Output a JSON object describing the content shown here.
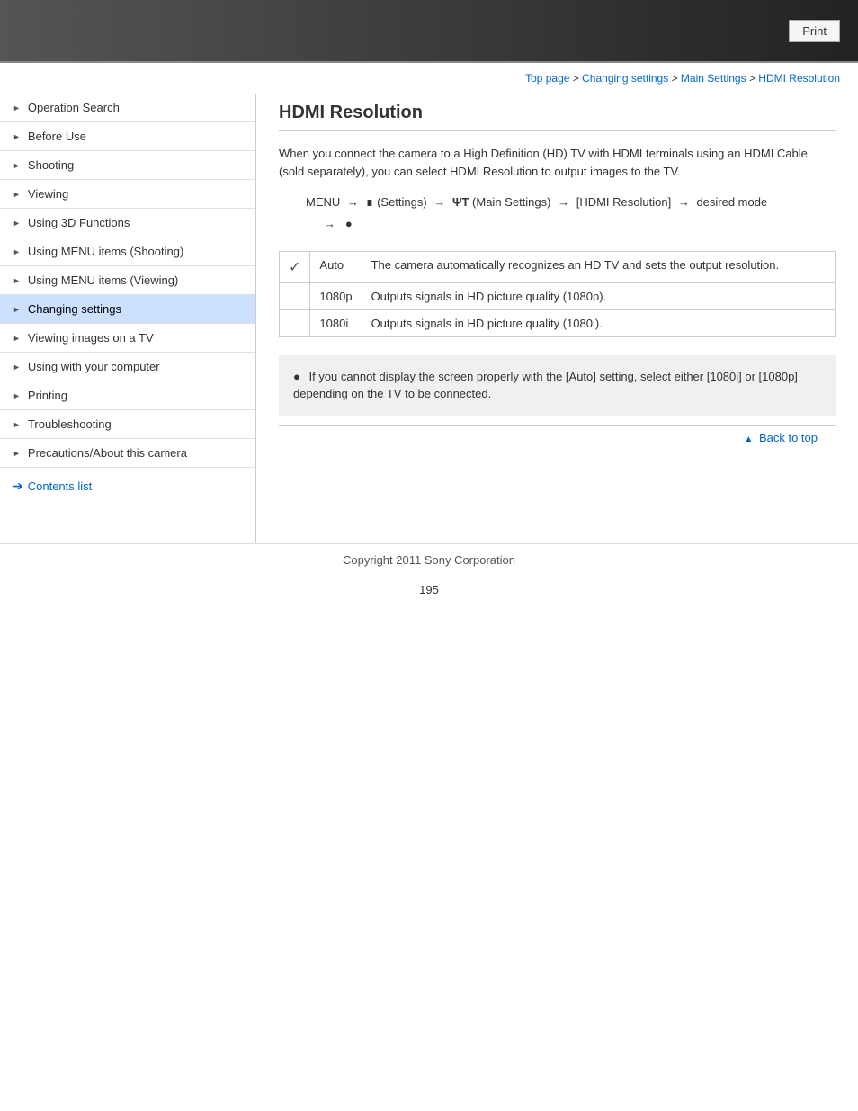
{
  "header": {
    "print_label": "Print"
  },
  "breadcrumb": {
    "items": [
      {
        "label": "Top page",
        "link": true
      },
      {
        "label": " > ",
        "link": false
      },
      {
        "label": "Changing settings",
        "link": true
      },
      {
        "label": " > ",
        "link": false
      },
      {
        "label": "Main Settings",
        "link": true
      },
      {
        "label": " > ",
        "link": false
      },
      {
        "label": "HDMI Resolution",
        "link": true
      }
    ]
  },
  "sidebar": {
    "items": [
      {
        "label": "Operation Search",
        "active": false
      },
      {
        "label": "Before Use",
        "active": false
      },
      {
        "label": "Shooting",
        "active": false
      },
      {
        "label": "Viewing",
        "active": false
      },
      {
        "label": "Using 3D Functions",
        "active": false
      },
      {
        "label": "Using MENU items (Shooting)",
        "active": false
      },
      {
        "label": "Using MENU items (Viewing)",
        "active": false
      },
      {
        "label": "Changing settings",
        "active": true
      },
      {
        "label": "Viewing images on a TV",
        "active": false
      },
      {
        "label": "Using with your computer",
        "active": false
      },
      {
        "label": "Printing",
        "active": false
      },
      {
        "label": "Troubleshooting",
        "active": false
      },
      {
        "label": "Precautions/About this camera",
        "active": false
      }
    ],
    "contents_list_label": "Contents list"
  },
  "main": {
    "title": "HDMI Resolution",
    "intro": "When you connect the camera to a High Definition (HD) TV with HDMI terminals using an HDMI Cable (sold separately), you can select HDMI Resolution to output images to the TV.",
    "menu_path": {
      "parts": [
        {
          "text": "MENU",
          "type": "text"
        },
        {
          "text": "→",
          "type": "arrow"
        },
        {
          "text": "⊞",
          "type": "icon"
        },
        {
          "text": "(Settings)",
          "type": "text"
        },
        {
          "text": "→",
          "type": "arrow"
        },
        {
          "text": "ΨT",
          "type": "icon"
        },
        {
          "text": "(Main Settings)",
          "type": "text"
        },
        {
          "text": "→",
          "type": "arrow"
        },
        {
          "text": "[HDMI Resolution]",
          "type": "text"
        },
        {
          "text": "→",
          "type": "arrow"
        },
        {
          "text": "desired mode",
          "type": "text"
        }
      ],
      "second_line": "→   ●"
    },
    "table": {
      "rows": [
        {
          "check": true,
          "mode": "Auto",
          "description": "The camera automatically recognizes an HD TV and sets the output resolution."
        },
        {
          "check": false,
          "mode": "1080p",
          "description": "Outputs signals in HD picture quality (1080p)."
        },
        {
          "check": false,
          "mode": "1080i",
          "description": "Outputs signals in HD picture quality (1080i)."
        }
      ]
    },
    "note": "If you cannot display the screen properly with the [Auto] setting, select either [1080i] or [1080p] depending on the TV to be connected.",
    "back_to_top": "Back to top"
  },
  "footer": {
    "copyright": "Copyright 2011 Sony Corporation",
    "page_number": "195"
  }
}
